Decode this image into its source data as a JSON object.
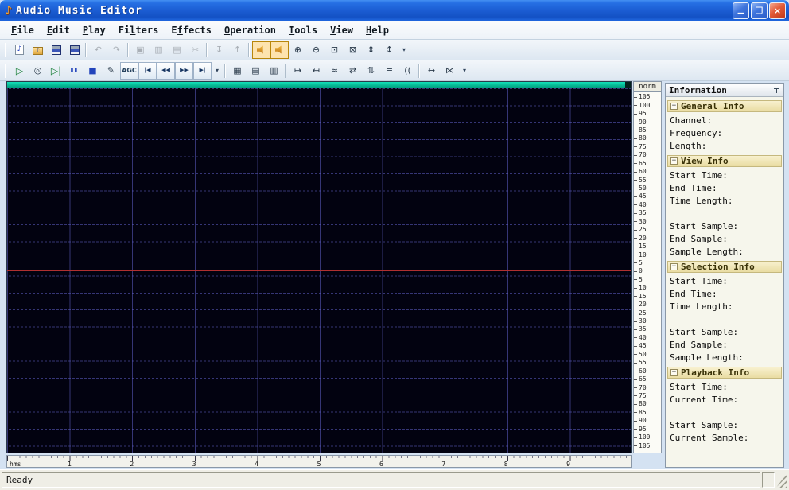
{
  "window": {
    "title": "Audio Music Editor",
    "app_icon": "♪",
    "controls": [
      {
        "name": "minimize-button",
        "icon": "minimize-icon",
        "glyph": "—",
        "kind": "wc-blue k-min"
      },
      {
        "name": "restore-button",
        "icon": "restore-icon",
        "glyph": "❐",
        "kind": "wc-blue"
      },
      {
        "name": "close-button",
        "icon": "close-icon",
        "glyph": "×",
        "kind": "wc-red"
      }
    ]
  },
  "menu": {
    "items": [
      {
        "name": "menu-file",
        "pre": "",
        "key": "F",
        "post": "ile"
      },
      {
        "name": "menu-edit",
        "pre": "",
        "key": "E",
        "post": "dit"
      },
      {
        "name": "menu-play",
        "pre": "",
        "key": "P",
        "post": "lay"
      },
      {
        "name": "menu-filters",
        "pre": "Fi",
        "key": "l",
        "post": "ters"
      },
      {
        "name": "menu-effects",
        "pre": "E",
        "key": "f",
        "post": "fects"
      },
      {
        "name": "menu-operation",
        "pre": "",
        "key": "O",
        "post": "peration"
      },
      {
        "name": "menu-tools",
        "pre": "",
        "key": "T",
        "post": "ools"
      },
      {
        "name": "menu-view",
        "pre": "",
        "key": "V",
        "post": "iew"
      },
      {
        "name": "menu-help",
        "pre": "",
        "key": "H",
        "post": "elp"
      }
    ]
  },
  "toolbar_main": {
    "buttons": [
      {
        "name": "new-file-button",
        "icon": "new-file-icon",
        "glyph": "♪",
        "kind": "k-doc"
      },
      {
        "name": "open-file-button",
        "icon": "open-folder-icon",
        "glyph": "♪",
        "kind": "k-folder"
      },
      {
        "name": "save-button",
        "icon": "save-icon",
        "glyph": "",
        "kind": "k-floppy"
      },
      {
        "name": "save-as-button",
        "icon": "save-as-icon",
        "glyph": "",
        "kind": "k-floppy"
      },
      {
        "name": "toolbar-separator",
        "icon": "separator",
        "glyph": "",
        "kind": "k-sep",
        "interactable": "false"
      },
      {
        "name": "undo-button",
        "icon": "undo-icon",
        "glyph": "↶",
        "kind": "k-dis"
      },
      {
        "name": "redo-button",
        "icon": "redo-icon",
        "glyph": "↷",
        "kind": "k-dis"
      },
      {
        "name": "toolbar-separator",
        "icon": "separator",
        "glyph": "",
        "kind": "k-sep",
        "interactable": "false"
      },
      {
        "name": "copy-to-new-button",
        "icon": "copy-to-new-icon",
        "glyph": "▣",
        "kind": "k-dis"
      },
      {
        "name": "copy-button",
        "icon": "copy-icon",
        "glyph": "▥",
        "kind": "k-dis"
      },
      {
        "name": "paste-button",
        "icon": "paste-icon",
        "glyph": "▤",
        "kind": "k-dis"
      },
      {
        "name": "cut-button",
        "icon": "cut-icon",
        "glyph": "✂",
        "kind": "k-dis"
      },
      {
        "name": "toolbar-separator",
        "icon": "separator",
        "glyph": "",
        "kind": "k-sep",
        "interactable": "false"
      },
      {
        "name": "mix-paste-button",
        "icon": "mix-paste-icon",
        "glyph": "↧",
        "kind": "k-dis"
      },
      {
        "name": "mix-copy-button",
        "icon": "mix-copy-icon",
        "glyph": "↥",
        "kind": "k-dis"
      },
      {
        "name": "toolbar-separator",
        "icon": "separator",
        "glyph": "",
        "kind": "k-sep",
        "interactable": "false"
      },
      {
        "name": "left-channel-monitor-toggle",
        "icon": "speaker-icon",
        "glyph": "",
        "kind": "k-speaker k-pressed"
      },
      {
        "name": "right-channel-monitor-toggle",
        "icon": "speaker-icon",
        "glyph": "",
        "kind": "k-speaker k-pressed"
      },
      {
        "name": "zoom-in-button",
        "icon": "zoom-in-icon",
        "glyph": "⊕",
        "kind": "k-dark"
      },
      {
        "name": "zoom-out-button",
        "icon": "zoom-out-icon",
        "glyph": "⊖",
        "kind": "k-dark"
      },
      {
        "name": "zoom-selection-button",
        "icon": "zoom-selection-icon",
        "glyph": "⊡",
        "kind": "k-dark"
      },
      {
        "name": "zoom-full-button",
        "icon": "zoom-full-icon",
        "glyph": "⊠",
        "kind": "k-dark"
      },
      {
        "name": "zoom-vertical-in-button",
        "icon": "zoom-vertical-in-icon",
        "glyph": "⇕",
        "kind": "k-dark"
      },
      {
        "name": "zoom-vertical-out-button",
        "icon": "zoom-vertical-out-icon",
        "glyph": "↕",
        "kind": "k-dark"
      },
      {
        "name": "toolbar-overflow-button",
        "icon": "chevron-down-icon",
        "glyph": "▾",
        "kind": "k-overflow"
      }
    ]
  },
  "toolbar_transport": {
    "buttons": [
      {
        "name": "play-button",
        "icon": "play-icon",
        "glyph": "▷",
        "kind": "k-green"
      },
      {
        "name": "play-loop-button",
        "icon": "loop-icon",
        "glyph": "◎",
        "kind": "k-dark"
      },
      {
        "name": "play-to-end-button",
        "icon": "play-to-end-icon",
        "glyph": "▷|",
        "kind": "k-green"
      },
      {
        "name": "pause-button",
        "icon": "pause-icon",
        "glyph": "▮▮",
        "kind": "k-blue k-pause"
      },
      {
        "name": "stop-button",
        "icon": "stop-icon",
        "glyph": "■",
        "kind": "k-blue"
      },
      {
        "name": "record-tool-button",
        "icon": "pencil-icon",
        "glyph": "✎",
        "kind": "k-dark"
      },
      {
        "name": "agc-toggle-button",
        "icon": "agc-label",
        "glyph": "AGC",
        "kind": "k-agc"
      },
      {
        "name": "go-to-start-button",
        "icon": "go-to-start-icon",
        "glyph": "|◀",
        "kind": "k-seek"
      },
      {
        "name": "rewind-button",
        "icon": "rewind-icon",
        "glyph": "◀◀",
        "kind": "k-seek"
      },
      {
        "name": "fast-forward-button",
        "icon": "fast-forward-icon",
        "glyph": "▶▶",
        "kind": "k-seek"
      },
      {
        "name": "go-to-end-button",
        "icon": "go-to-end-icon",
        "glyph": "▶|",
        "kind": "k-seek"
      },
      {
        "name": "transport-overflow-button",
        "icon": "chevron-down-icon",
        "glyph": "▾",
        "kind": "k-overflow"
      },
      {
        "name": "toolbar-separator",
        "icon": "separator",
        "glyph": "",
        "kind": "k-sep",
        "interactable": "false"
      },
      {
        "name": "grid-dense-button",
        "icon": "grid-dense-icon",
        "glyph": "▦",
        "kind": "k-dark"
      },
      {
        "name": "grid-medium-button",
        "icon": "grid-medium-icon",
        "glyph": "▤",
        "kind": "k-dark"
      },
      {
        "name": "grid-off-button",
        "icon": "grid-off-icon",
        "glyph": "▥",
        "kind": "k-dark"
      },
      {
        "name": "toolbar-separator",
        "icon": "separator",
        "glyph": "",
        "kind": "k-sep",
        "interactable": "false"
      },
      {
        "name": "selection-start-button",
        "icon": "selection-start-icon",
        "glyph": "↦",
        "kind": "k-dark"
      },
      {
        "name": "selection-end-button",
        "icon": "selection-end-icon",
        "glyph": "↤",
        "kind": "k-dark"
      },
      {
        "name": "smooth-wave-button",
        "icon": "wave-icon",
        "glyph": "≈",
        "kind": "k-dark"
      },
      {
        "name": "swap-channels-button",
        "icon": "swap-icon",
        "glyph": "⇄",
        "kind": "k-dark"
      },
      {
        "name": "flip-vertical-button",
        "icon": "flip-vertical-icon",
        "glyph": "⇅",
        "kind": "k-dark"
      },
      {
        "name": "link-channels-button",
        "icon": "link-icon",
        "glyph": "≡",
        "kind": "k-dark"
      },
      {
        "name": "loudness-button",
        "icon": "sound-waves-icon",
        "glyph": "((",
        "kind": "k-dark"
      },
      {
        "name": "toolbar-separator",
        "icon": "separator",
        "glyph": "",
        "kind": "k-sep",
        "interactable": "false"
      },
      {
        "name": "fit-width-button",
        "icon": "fit-width-icon",
        "glyph": "↔",
        "kind": "k-dark"
      },
      {
        "name": "collapse-selection-button",
        "icon": "collapse-icon",
        "glyph": "⋈",
        "kind": "k-dark"
      },
      {
        "name": "transport-overflow-button-2",
        "icon": "chevron-down-icon",
        "glyph": "▾",
        "kind": "k-overflow"
      }
    ]
  },
  "waveform": {
    "norm_label": "norm",
    "scale_values": [
      "105",
      "100",
      "95",
      "90",
      "85",
      "80",
      "75",
      "70",
      "65",
      "60",
      "55",
      "50",
      "45",
      "40",
      "35",
      "30",
      "25",
      "20",
      "15",
      "10",
      "5",
      "0",
      "5",
      "10",
      "15",
      "20",
      "25",
      "30",
      "35",
      "40",
      "45",
      "50",
      "55",
      "60",
      "65",
      "70",
      "75",
      "80",
      "85",
      "90",
      "95",
      "100",
      "105"
    ],
    "colors": {
      "background": "#020210",
      "grid": "#5F5FC8",
      "center_line": "#B03030",
      "position_bar": "#00C49E"
    }
  },
  "time_ruler": {
    "unit_label": "hms",
    "ticks": [
      "1",
      "2",
      "3",
      "4",
      "5",
      "6",
      "7",
      "8",
      "9"
    ]
  },
  "info_panel": {
    "title": "Information",
    "collapse_glyph": "−",
    "sections": [
      {
        "title": "General Info",
        "groups": [
          [
            "Channel:",
            "Frequency:",
            "Length:"
          ]
        ]
      },
      {
        "title": "View Info",
        "groups": [
          [
            "Start Time:",
            "End Time:",
            "Time Length:"
          ],
          [
            "Start Sample:",
            "End Sample:",
            "Sample Length:"
          ]
        ]
      },
      {
        "title": "Selection Info",
        "groups": [
          [
            "Start Time:",
            "End Time:",
            "Time Length:"
          ],
          [
            "Start Sample:",
            "End Sample:",
            "Sample Length:"
          ]
        ]
      },
      {
        "title": "Playback Info",
        "groups": [
          [
            "Start Time:",
            "Current Time:"
          ],
          [
            "Start Sample:",
            "Current Sample:"
          ]
        ]
      }
    ]
  },
  "status_bar": {
    "text": "Ready"
  }
}
